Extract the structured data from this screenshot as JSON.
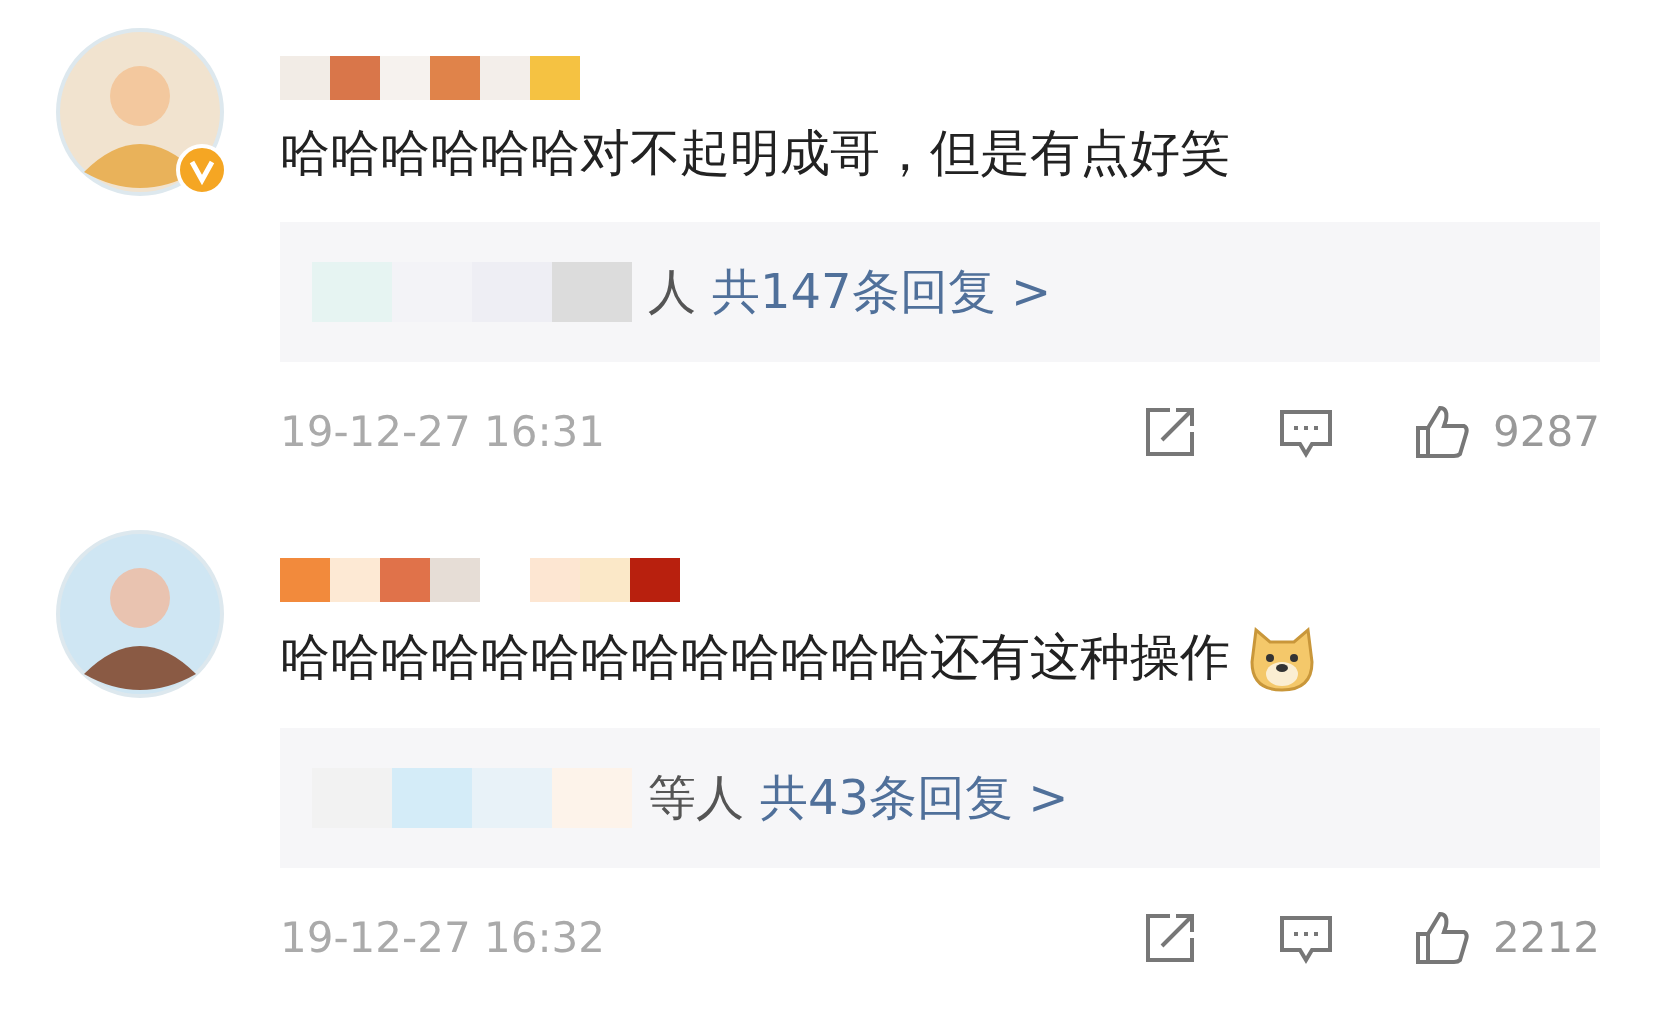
{
  "comments": [
    {
      "verified": true,
      "text": "哈哈哈哈哈哈对不起明成哥，但是有点好笑",
      "dog_emoji": false,
      "replies": {
        "suffix": "人",
        "link": "共147条回复 >"
      },
      "time": "19-12-27 16:31",
      "likes": "9287"
    },
    {
      "verified": false,
      "text": "哈哈哈哈哈哈哈哈哈哈哈哈哈还有这种操作",
      "dog_emoji": true,
      "replies": {
        "suffix": "等人",
        "link": "共43条回复 >"
      },
      "time": "19-12-27 16:32",
      "likes": "2212"
    }
  ]
}
